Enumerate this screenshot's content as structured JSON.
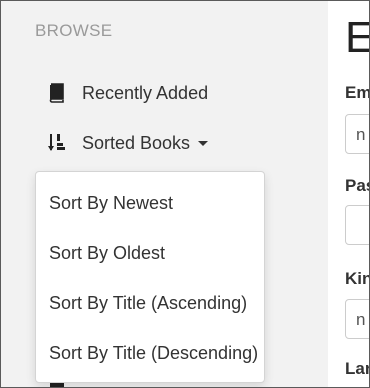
{
  "sidebar": {
    "heading": "BROWSE",
    "items": [
      {
        "label": "Recently Added",
        "icon": "book-icon"
      },
      {
        "label": "Sorted Books",
        "icon": "sort-numeric-icon"
      }
    ]
  },
  "dropdown": {
    "items": [
      {
        "label": "Sort By Newest"
      },
      {
        "label": "Sort By Oldest"
      },
      {
        "label": "Sort By Title (Ascending)"
      },
      {
        "label": "Sort By Title (Descending)"
      }
    ]
  },
  "main": {
    "title": "E",
    "fields": [
      {
        "label": "Em",
        "value": "n"
      },
      {
        "label": "Pas",
        "value": ""
      },
      {
        "label": "Kin",
        "value": "n"
      },
      {
        "label": "Lan"
      }
    ]
  }
}
